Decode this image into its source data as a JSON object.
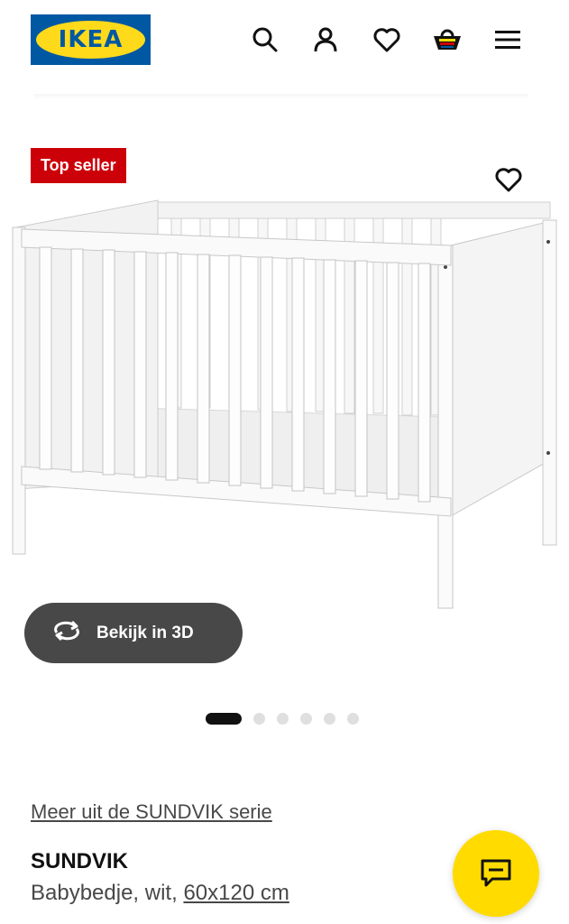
{
  "header": {
    "logo_text": "IKEA",
    "icons": [
      "search-icon",
      "user-icon",
      "heart-icon",
      "basket-icon",
      "menu-icon"
    ]
  },
  "product": {
    "badge": "Top seller",
    "view_3d_label": "Bekijk in 3D",
    "carousel": {
      "count": 6,
      "active_index": 0
    },
    "series_link": "Meer uit de SUNDVIK serie",
    "name": "SUNDVIK",
    "description_prefix": "Babybedje, wit, ",
    "size": "60x120 cm"
  },
  "colors": {
    "brand_blue": "#0058a3",
    "brand_yellow": "#ffda1a",
    "badge_red": "#cc0008",
    "button_dark": "#484848",
    "chat_yellow": "#ffdb00"
  }
}
